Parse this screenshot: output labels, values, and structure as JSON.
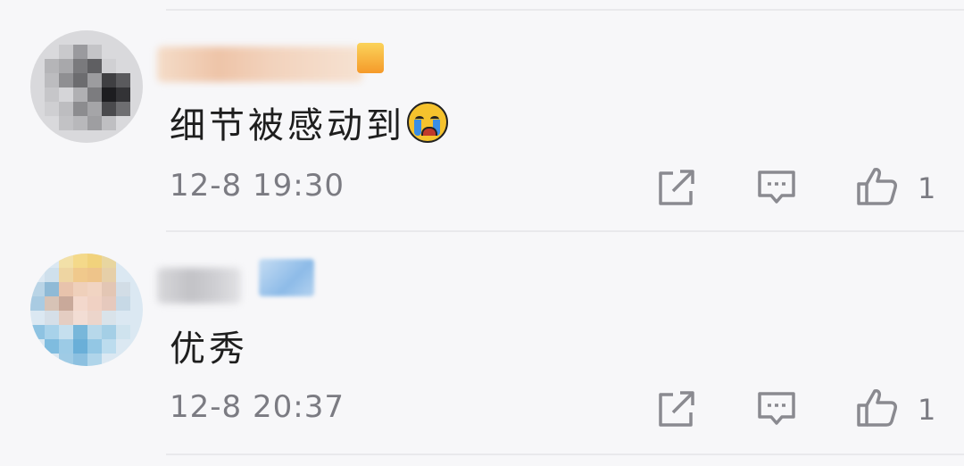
{
  "comments": [
    {
      "content": "细节被感动到",
      "emoji": "crying-face",
      "time": "12-8 19:30",
      "likes": "1"
    },
    {
      "content": "优秀",
      "time": "12-8 20:37",
      "likes": "1"
    }
  ],
  "icons": {
    "share": "share-icon",
    "reply": "comment-icon",
    "like": "thumbs-up-icon"
  },
  "colors": {
    "background": "#f7f7f9",
    "text": "#1e1e1e",
    "meta": "#7b7b82",
    "icon": "#8a8a90"
  }
}
